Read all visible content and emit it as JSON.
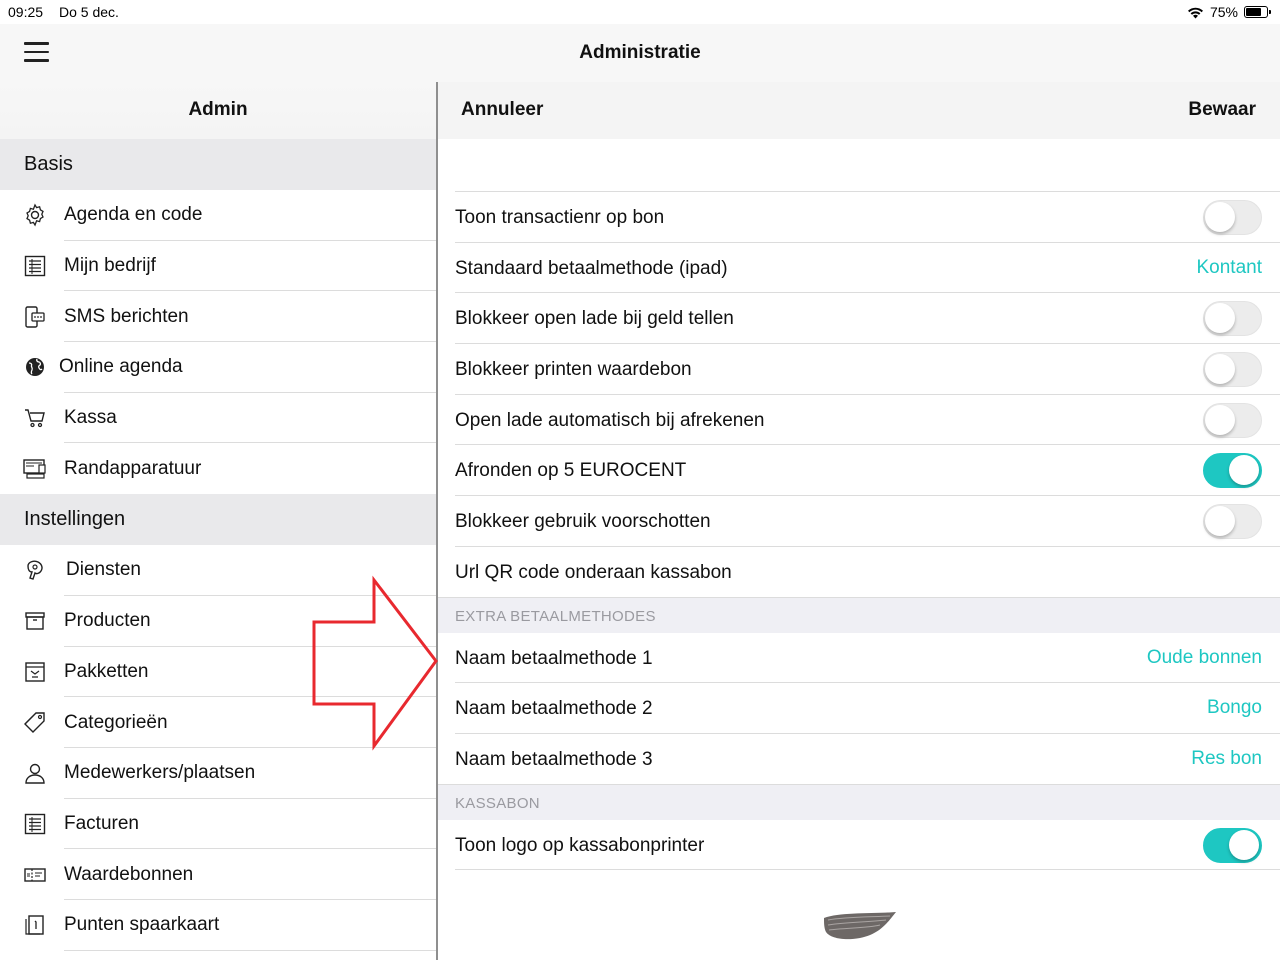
{
  "status_bar": {
    "time": "09:25",
    "date": "Do 5 dec.",
    "battery": "75%",
    "battery_level": 0.75
  },
  "navbar": {
    "title": "Administratie"
  },
  "left_panel": {
    "title": "Admin",
    "sections": [
      {
        "title": "Basis",
        "items": [
          {
            "label": "Agenda en code",
            "icon": "gear-icon"
          },
          {
            "label": "Mijn bedrijf",
            "icon": "list-icon"
          },
          {
            "label": "SMS berichten",
            "icon": "phone-message-icon"
          },
          {
            "label": "Online agenda",
            "icon": "globe-icon"
          },
          {
            "label": "Kassa",
            "icon": "cart-icon"
          },
          {
            "label": "Randapparatuur",
            "icon": "devices-icon"
          }
        ]
      },
      {
        "title": "Instellingen",
        "items": [
          {
            "label": "Diensten",
            "icon": "hair-dryer-icon"
          },
          {
            "label": "Producten",
            "icon": "box-icon"
          },
          {
            "label": "Pakketten",
            "icon": "package-icon"
          },
          {
            "label": "Categorieën",
            "icon": "tags-icon"
          },
          {
            "label": "Medewerkers/plaatsen",
            "icon": "person-icon"
          },
          {
            "label": "Facturen",
            "icon": "list-icon"
          },
          {
            "label": "Waardebonnen",
            "icon": "voucher-icon"
          },
          {
            "label": "Punten spaarkaart",
            "icon": "card-icon"
          }
        ]
      }
    ]
  },
  "right_panel": {
    "cancel_label": "Annuleer",
    "save_label": "Bewaar",
    "rows": [
      {
        "label": "Toon transactienr op bon",
        "type": "toggle",
        "on": false
      },
      {
        "label": "Standaard betaalmethode (ipad)",
        "type": "value",
        "value": "Kontant"
      },
      {
        "label": "Blokkeer open lade bij geld tellen",
        "type": "toggle",
        "on": false
      },
      {
        "label": "Blokkeer printen waardebon",
        "type": "toggle",
        "on": false
      },
      {
        "label": "Open lade automatisch bij afrekenen",
        "type": "toggle",
        "on": false
      },
      {
        "label": "Afronden op 5 EUROCENT",
        "type": "toggle",
        "on": true
      },
      {
        "label": "Blokkeer gebruik voorschotten",
        "type": "toggle",
        "on": false
      },
      {
        "label": "Url QR code onderaan kassabon",
        "type": "text"
      }
    ],
    "extra_header": "EXTRA BETAALMETHODES",
    "extra_rows": [
      {
        "label": "Naam betaalmethode 1",
        "value": "Oude bonnen"
      },
      {
        "label": "Naam betaalmethode 2",
        "value": "Bongo"
      },
      {
        "label": "Naam betaalmethode 3",
        "value": "Res bon"
      }
    ],
    "receipt_header": "KASSABON",
    "receipt_rows": [
      {
        "label": "Toon logo op kassabonprinter",
        "type": "toggle",
        "on": true
      }
    ]
  },
  "colors": {
    "accent": "#1ec7c2",
    "section_bg": "#e9e9eb",
    "arrow": "#e8292f"
  }
}
